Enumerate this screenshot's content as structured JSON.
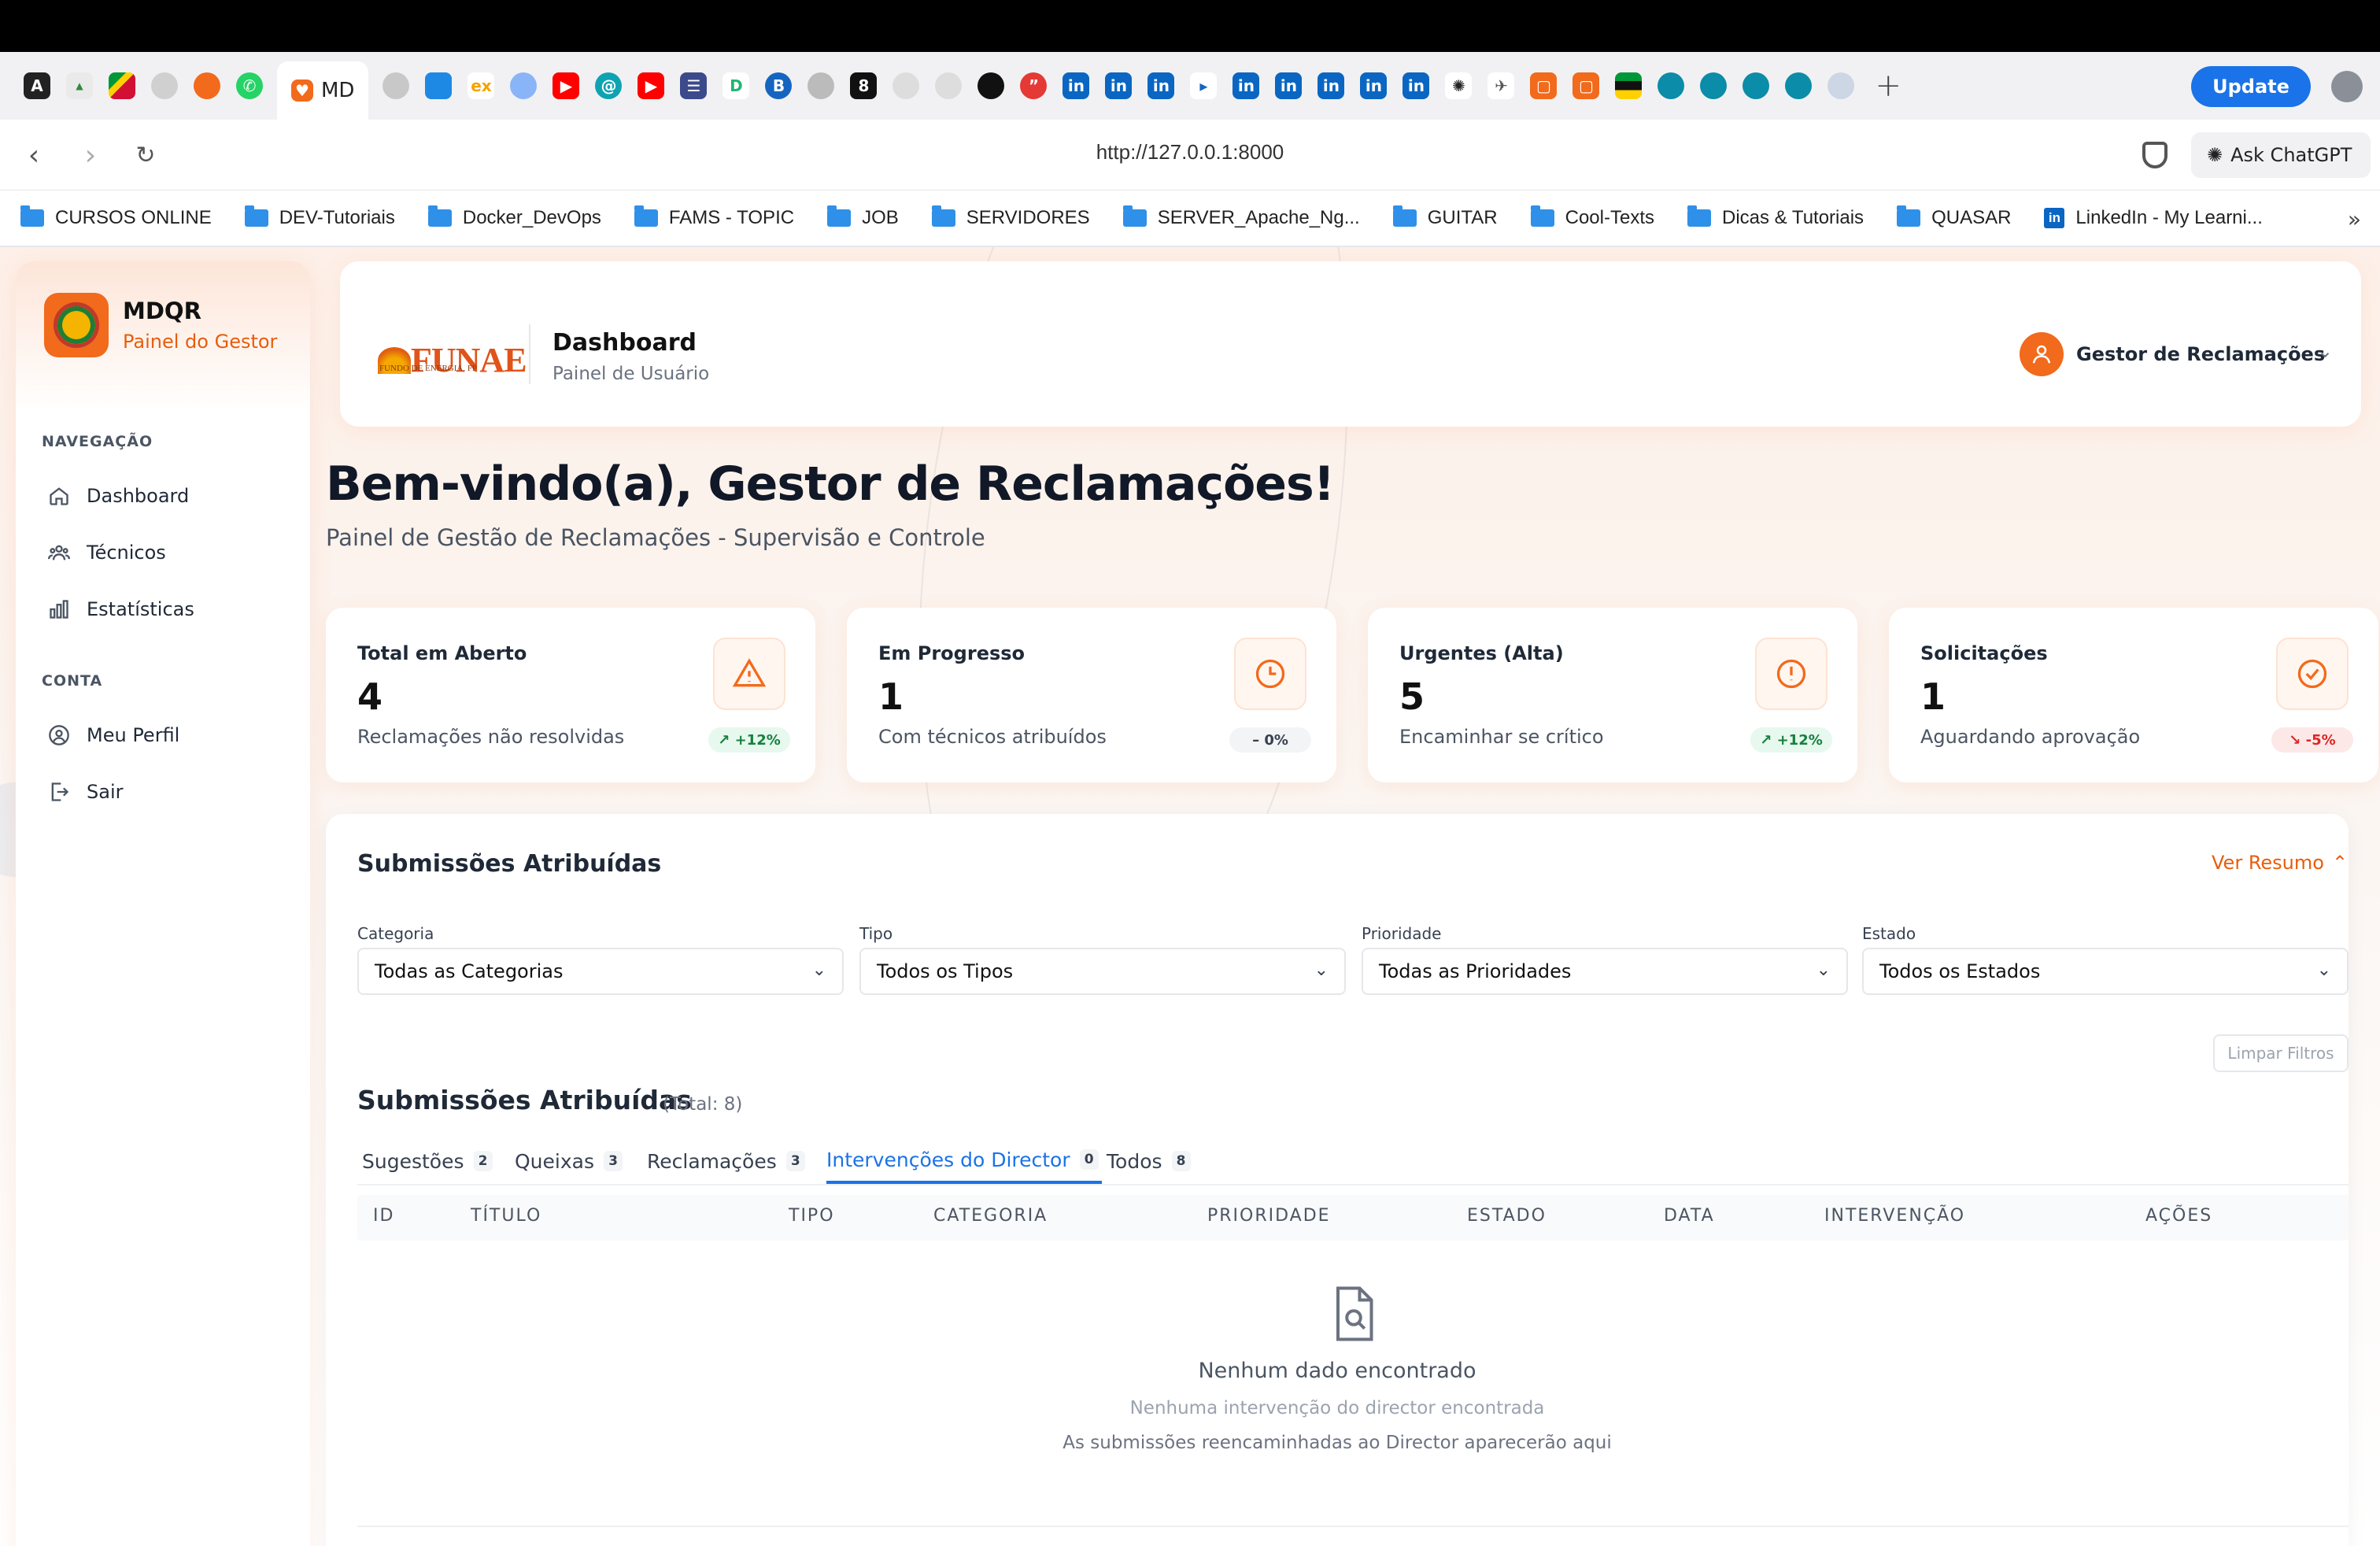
{
  "browser": {
    "active_tab_label": "MD",
    "update_label": "Update",
    "url": "http://127.0.0.1:8000",
    "ask_chatgpt": "Ask ChatGPT",
    "bookmarks": [
      {
        "label": "CURSOS ONLINE",
        "icon": "folder-icon"
      },
      {
        "label": "DEV-Tutoriais",
        "icon": "folder-icon"
      },
      {
        "label": "Docker_DevOps",
        "icon": "folder-icon"
      },
      {
        "label": "FAMS - TOPIC",
        "icon": "folder-icon"
      },
      {
        "label": "JOB",
        "icon": "folder-icon"
      },
      {
        "label": "SERVIDORES",
        "icon": "folder-icon"
      },
      {
        "label": "SERVER_Apache_Ng...",
        "icon": "folder-icon"
      },
      {
        "label": "GUITAR",
        "icon": "folder-icon"
      },
      {
        "label": "Cool-Texts",
        "icon": "folder-icon"
      },
      {
        "label": "Dicas & Tutoriais",
        "icon": "folder-icon"
      },
      {
        "label": "QUASAR",
        "icon": "folder-icon"
      },
      {
        "label": "LinkedIn - My Learni...",
        "icon": "linkedin-icon"
      }
    ]
  },
  "sidebar": {
    "title": "MDQR",
    "subtitle": "Painel do Gestor",
    "nav_section": "NAVEGAÇÃO",
    "nav_items": [
      {
        "label": "Dashboard",
        "icon": "home-icon"
      },
      {
        "label": "Técnicos",
        "icon": "users-icon"
      },
      {
        "label": "Estatísticas",
        "icon": "bar-chart-icon"
      }
    ],
    "account_section": "CONTA",
    "account_items": [
      {
        "label": "Meu Perfil",
        "icon": "user-circle-icon"
      },
      {
        "label": "Sair",
        "icon": "logout-icon"
      }
    ]
  },
  "header": {
    "logo_text": "FUNAE",
    "logo_subtext": "FUNDO DE ENERGIA, FP",
    "title": "Dashboard",
    "subtitle": "Painel de Usuário",
    "user_name": "Gestor de Reclamações"
  },
  "welcome": {
    "title": "Bem-vindo(a), Gestor de Reclamações!",
    "subtitle": "Painel de Gestão de Reclamações - Supervisão e Controle"
  },
  "stats": [
    {
      "label": "Total em Aberto",
      "value": "4",
      "desc": "Reclamações não resolvidas",
      "trend": "↗ +12%",
      "trend_dir": "up",
      "icon": "warning-icon"
    },
    {
      "label": "Em Progresso",
      "value": "1",
      "desc": "Com técnicos atribuídos",
      "trend": "– 0%",
      "trend_dir": "flat",
      "icon": "clock-icon"
    },
    {
      "label": "Urgentes (Alta)",
      "value": "5",
      "desc": "Encaminhar se crítico",
      "trend": "↗ +12%",
      "trend_dir": "up",
      "icon": "alert-circle-icon"
    },
    {
      "label": "Solicitações",
      "value": "1",
      "desc": "Aguardando aprovação",
      "trend": "↘ -5%",
      "trend_dir": "down",
      "icon": "check-circle-icon"
    }
  ],
  "submissions": {
    "card_title": "Submissões Atribuídas",
    "ver_resumo": "Ver Resumo",
    "filters": [
      {
        "label": "Categoria",
        "value": "Todas as Categorias"
      },
      {
        "label": "Tipo",
        "value": "Todos os Tipos"
      },
      {
        "label": "Prioridade",
        "value": "Todas as Prioridades"
      },
      {
        "label": "Estado",
        "value": "Todos os Estados"
      }
    ],
    "clear_filters": "Limpar Filtros",
    "list_title": "Submissões Atribuídas",
    "total": "(Total: 8)",
    "tabs": [
      {
        "label": "Sugestões",
        "count": "2"
      },
      {
        "label": "Queixas",
        "count": "3"
      },
      {
        "label": "Reclamações",
        "count": "3"
      },
      {
        "label": "Intervenções do Director",
        "count": "0"
      },
      {
        "label": "Todos",
        "count": "8"
      }
    ],
    "active_tab": "Intervenções do Director",
    "columns": [
      "ID",
      "TÍTULO",
      "TIPO",
      "CATEGORIA",
      "PRIORIDADE",
      "ESTADO",
      "DATA",
      "INTERVENÇÃO",
      "AÇÕES"
    ],
    "empty": {
      "title": "Nenhum dado encontrado",
      "subtitle": "Nenhuma intervenção do director encontrada",
      "hint": "As submissões reencaminhadas ao Director aparecerão aqui"
    }
  },
  "colors": {
    "accent": "#f26a1b",
    "link": "#1a73e8"
  }
}
